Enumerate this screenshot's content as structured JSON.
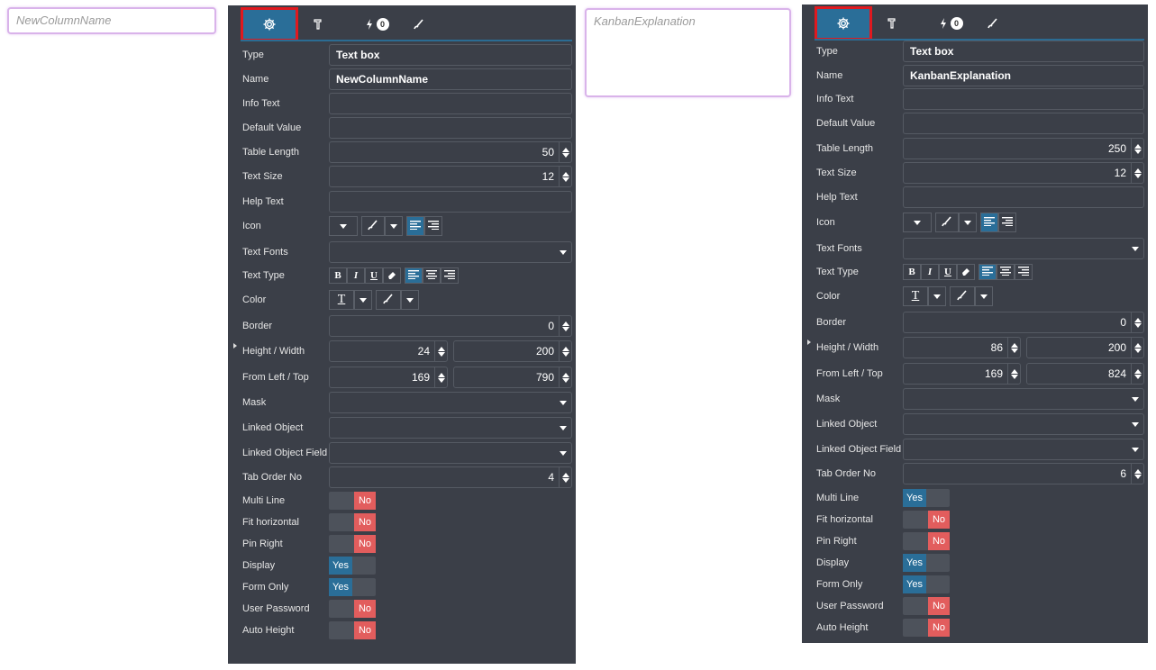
{
  "previews": [
    {
      "placeholder": "NewColumnName"
    },
    {
      "placeholder": "KanbanExplanation"
    }
  ],
  "tabs": {
    "events_badge": "0"
  },
  "labels": {
    "type": "Type",
    "name": "Name",
    "info_text": "Info Text",
    "default_value": "Default Value",
    "table_length": "Table Length",
    "text_size": "Text Size",
    "help_text": "Help Text",
    "icon": "Icon",
    "text_fonts": "Text Fonts",
    "text_type": "Text Type",
    "color": "Color",
    "border": "Border",
    "height_width": "Height / Width",
    "from_left_top": "From Left / Top",
    "mask": "Mask",
    "linked_object": "Linked Object",
    "linked_object_field": "Linked Object Field",
    "tab_order_no": "Tab Order No",
    "multi_line": "Multi Line",
    "fit_horizontal": "Fit horizontal",
    "pin_right": "Pin Right",
    "display": "Display",
    "form_only": "Form Only",
    "user_password": "User Password",
    "auto_height": "Auto Height"
  },
  "toggle_text": {
    "yes": "Yes",
    "no": "No"
  },
  "text_type_buttons": {
    "bold": "B",
    "italic": "I",
    "underline": "U"
  },
  "color_glyph": "T",
  "panels": [
    {
      "type": "Text box",
      "name": "NewColumnName",
      "info_text": "",
      "default_value": "",
      "table_length": "50",
      "text_size": "12",
      "help_text": "",
      "border": "0",
      "height": "24",
      "width": "200",
      "left": "169",
      "top": "790",
      "tab_order_no": "4",
      "toggles": {
        "multi_line": "No",
        "fit_horizontal": "No",
        "pin_right": "No",
        "display": "Yes",
        "form_only": "Yes",
        "user_password": "No",
        "auto_height": "No"
      }
    },
    {
      "type": "Text box",
      "name": "KanbanExplanation",
      "info_text": "",
      "default_value": "",
      "table_length": "250",
      "text_size": "12",
      "help_text": "",
      "border": "0",
      "height": "86",
      "width": "200",
      "left": "169",
      "top": "824",
      "tab_order_no": "6",
      "toggles": {
        "multi_line": "Yes",
        "fit_horizontal": "No",
        "pin_right": "No",
        "display": "Yes",
        "form_only": "Yes",
        "user_password": "No",
        "auto_height": "No"
      }
    }
  ],
  "colors": {
    "panel_bg": "#3b3f48",
    "accent_blue": "#2a6e98",
    "no_red": "#e25d5d",
    "active_tab_border": "#e0191f",
    "preview_border": "#d9b3ea"
  }
}
